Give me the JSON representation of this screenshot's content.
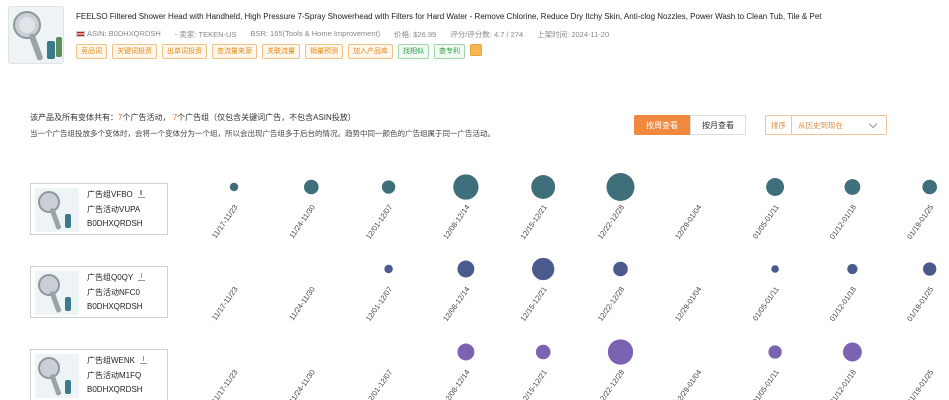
{
  "product": {
    "title": "FEELSO Filtered Shower Head with Handheld, High Pressure 7-Spray Showerhead with Filters for Hard Water - Remove Chlorine, Reduce Dry Itchy Skin, Anti-clog Nozzles, Power Wash to Clean Tub, Tile & Pet",
    "asin": "ASIN: B0DHXQRDSH",
    "seller": "- 卖家: TEKEN-US",
    "bsr": "BSR: 165(Tools & Home Improvement)",
    "price": "价格: $26.99",
    "rating": "评分/评分数: 4.7 / 274",
    "launch": "上架时间: 2024-11-20",
    "tags": [
      {
        "label": "竞品词",
        "style": "orange"
      },
      {
        "label": "关键词投资",
        "style": "orange"
      },
      {
        "label": "出单词投资",
        "style": "orange"
      },
      {
        "label": "查流量来源",
        "style": "orange"
      },
      {
        "label": "关联流量",
        "style": "orange"
      },
      {
        "label": "销量预测",
        "style": "orange"
      },
      {
        "label": "加入产品库",
        "style": "orange"
      },
      {
        "label": "找相似",
        "style": "green"
      },
      {
        "label": "查专利",
        "style": "green"
      }
    ]
  },
  "summary": {
    "prefix": "该产品及所有变体共有：",
    "campaign_count": "7",
    "campaign_label": "个广告活动，",
    "group_count": "7",
    "group_label": "个广告组（仅包含关键词广告，不包含ASIN投放）",
    "note": "当一个广告组投放多个变体时，会将一个变体分为一个组，所以会出现广告组多于后台的情况。趋势中同一颜色的广告组属于同一广告活动。"
  },
  "controls": {
    "by_week": "按周查看",
    "by_month": "按月查看",
    "sort_label": "排序",
    "sort_value": "从历史到现在"
  },
  "groups": [
    {
      "name": "广告组VFBO",
      "campaign": "广告活动VUPA",
      "asin": "B0DHXQRDSH"
    },
    {
      "name": "广告组Q0QY",
      "campaign": "广告活动NFC0",
      "asin": "B0DHXQRDSH"
    },
    {
      "name": "广告组WENK",
      "campaign": "广告活动M1FQ",
      "asin": "B0DHXQRDSH"
    }
  ],
  "chart_data": {
    "type": "scatter",
    "x": [
      "11/17-11/23",
      "11/24-11/30",
      "12/01-12/07",
      "12/08-12/14",
      "12/15-12/21",
      "12/22-12/28",
      "12/29-01/04",
      "01/05-01/11",
      "01/12-01/18",
      "01/19-01/25"
    ],
    "series": [
      {
        "values": [
          1,
          3,
          2.5,
          9,
          8,
          11,
          0,
          4.5,
          3.5,
          3
        ],
        "color": "#3f6f7a"
      },
      {
        "values": [
          0,
          0,
          1,
          4,
          7,
          3,
          0,
          0.8,
          1.5,
          2.5
        ],
        "color": "#4a5a8c"
      },
      {
        "values": [
          0,
          0,
          0,
          4,
          3,
          9,
          0,
          2.5,
          5,
          0
        ],
        "color": "#7b62b3"
      }
    ]
  }
}
